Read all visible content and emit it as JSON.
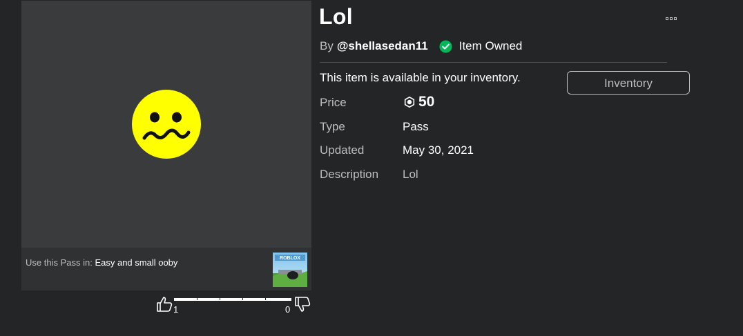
{
  "item": {
    "title": "Lol",
    "by_label": "By",
    "creator": "@shellasedan11",
    "owned_label": "Item Owned",
    "availability": "This item is available in your inventory.",
    "inventory_button": "Inventory"
  },
  "details": {
    "price_label": "Price",
    "price_value": "50",
    "type_label": "Type",
    "type_value": "Pass",
    "updated_label": "Updated",
    "updated_value": "May 30, 2021",
    "description_label": "Description",
    "description_value": "Lol"
  },
  "usage": {
    "prefix": "Use this Pass in:",
    "game_name": "Easy and small ooby",
    "game_thumb_text": "ROBLOX"
  },
  "votes": {
    "up_count": "1",
    "down_count": "0",
    "up_fraction": 1.0
  },
  "icons": {
    "thumbnail": "confused-face-icon",
    "owned": "check-circle-icon",
    "currency": "robux-icon",
    "more": "more-options-icon",
    "upvote": "thumbs-up-icon",
    "downvote": "thumbs-down-icon"
  },
  "colors": {
    "background": "#232527",
    "panel": "#393b3d",
    "owned_green": "#02b757",
    "face_yellow": "#ffff00"
  }
}
